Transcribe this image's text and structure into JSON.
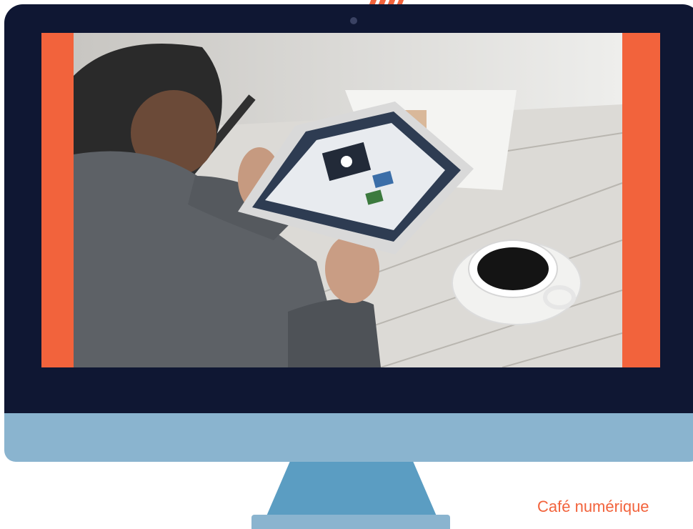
{
  "caption": "Café numérique",
  "colors": {
    "accent": "#f2633c",
    "bezel": "#0f1733",
    "chin": "#8ab4cf",
    "stand": "#5b9dc2"
  },
  "icons": {
    "camera": "camera-dot",
    "photo": "man-with-tablet-and-coffee"
  }
}
